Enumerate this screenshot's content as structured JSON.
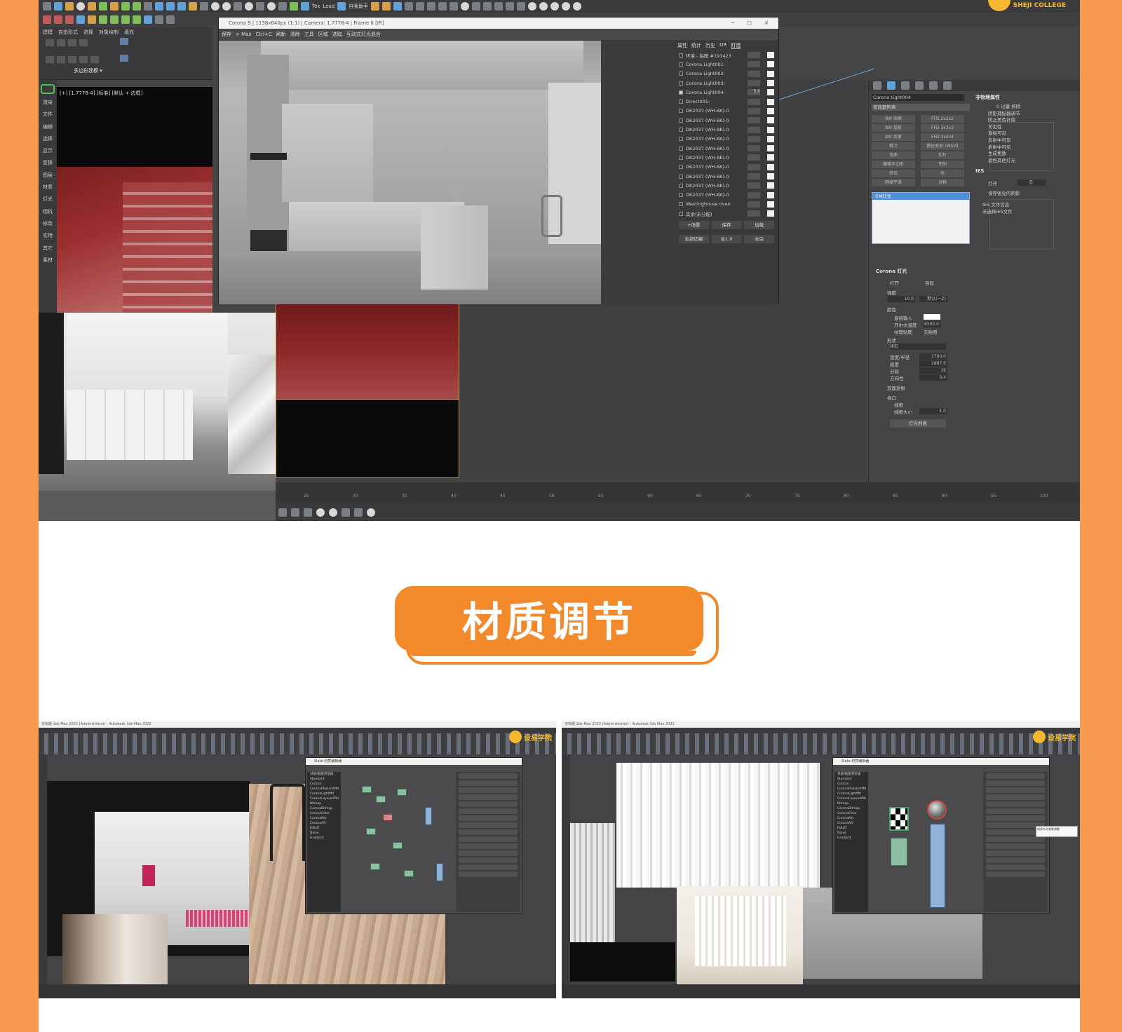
{
  "top_screenshot": {
    "logo_text": "SHEJI COLLEGE",
    "toolbar_text_1": "Tex",
    "toolbar_text_2": "Lead",
    "toolbar_text_3": "自我助手",
    "command_tabs": [
      "建模",
      "自由形式",
      "选择",
      "对象绘制",
      "填充"
    ],
    "command_sub_label": "多边形建模 ▾",
    "left_strip_items": [
      "渲染",
      "文件",
      "编辑",
      "选择",
      "显示",
      "变换",
      "图层",
      "材质",
      "灯光",
      "相机",
      "修改",
      "实用",
      "其它",
      "素材"
    ],
    "viewport_label": "[+] [1.7778-4] [标准] [默认 + 边框]",
    "render_window": {
      "title": "Corona 9 | 1138x640px (1:1) | Camera: 1.7778-4 | Frame 0 [IR]",
      "tools": [
        "保存",
        "> Max",
        "Ctrl+C",
        "刷新",
        "清除",
        "工具",
        "区域",
        "选取",
        "互动式灯光混合"
      ],
      "side_tabs": [
        "属性",
        "统计",
        "历史",
        "DR",
        "灯混"
      ],
      "lights": [
        {
          "name": "环境 - 贴图 #191423",
          "on": false
        },
        {
          "name": "Corona Light001:",
          "on": false
        },
        {
          "name": "Corona Light002:",
          "on": false
        },
        {
          "name": "Corona Light003:",
          "on": false
        },
        {
          "name": "Corona Light004:",
          "on": true,
          "value": "5.0"
        },
        {
          "name": "Direct001:",
          "on": false
        },
        {
          "name": "DK2037 (WH-BK)-0",
          "on": false
        },
        {
          "name": "DK2037 (WH-BK)-0",
          "on": false
        },
        {
          "name": "DK2037 (WH-BK)-0",
          "on": false
        },
        {
          "name": "DK2037 (WH-BK)-0",
          "on": false
        },
        {
          "name": "DK2037 (WH-BK)-0",
          "on": false
        },
        {
          "name": "DK2037 (WH-BK)-0",
          "on": false
        },
        {
          "name": "DK2037 (WH-BK)-0",
          "on": false
        },
        {
          "name": "DK2037 (WH-BK)-0",
          "on": false
        },
        {
          "name": "DK2037 (WH-BK)-0",
          "on": false
        },
        {
          "name": "DK2037 (WH-BK)-0",
          "on": false
        },
        {
          "name": "Westinghouse oven",
          "on": false
        },
        {
          "name": "其余(未分配)",
          "on": false
        }
      ],
      "buttons_row1": [
        "+场景",
        "保存",
        "加载"
      ],
      "buttons_row2": [
        "全部切换",
        "全1.0",
        "全白"
      ]
    },
    "command_right": {
      "object_name": "Corona Light004",
      "dropdown": "修改器列表",
      "grid_buttons": [
        "BW 贴图",
        "FFD 2x2x2",
        "BW 投影",
        "FFD 3x3x3",
        "BW 反射",
        "FFD 4x4x4",
        "推力",
        "路径变形 (WSM)",
        "弯曲",
        "切片",
        "编辑多边形",
        "车削",
        "挤出",
        "壳",
        "网格平滑",
        "对称"
      ],
      "list_selected": "CM灯光",
      "sec_corona_light": "Corona 灯光",
      "chk_on": "打开",
      "chk_target": "目标",
      "intensity_label": "强度",
      "intensity_value": "10.0",
      "unit_value": "默认(一Z)",
      "color_label": "颜色",
      "color_direct": "直接输入",
      "color_kelvin": "开尔文温度",
      "kelvin_value": "6500.0",
      "color_map": "纹理贴图",
      "no_map": "无贴图",
      "shape_label": "形状",
      "shape_value": "矩形",
      "width_label": "宽度/半径",
      "width_value": "1700.0",
      "height_label": "高度",
      "height_value": "2887.6",
      "segments_label": "分段",
      "segments_value": "16",
      "directionality_label": "方向性",
      "directionality_value": "0.4",
      "twosided": "双面发射",
      "viewport_label": "视口",
      "wireframe": "线框",
      "wire_size_label": "线框大小",
      "wire_size_value": "1.0",
      "light_list_button": "灯光列表",
      "prop_sec": "非物理属性",
      "prop_items": [
        "0 过量 排除",
        "阴影捕捉器调节",
        "防止黑色补偿",
        "可见性",
        "直接可见",
        "反射中可见",
        "折射中可见",
        "生成焦散",
        "遮挡其他灯光"
      ],
      "ies_sec": "IES",
      "ies_on": "打开",
      "ies_none": "无",
      "ies_keep": "保存锐化的阴影",
      "ies_info": "IES 文件信息",
      "ies_none_file": "未选择IES文件"
    },
    "timeline_ticks": [
      "25",
      "30",
      "35",
      "40",
      "45",
      "50",
      "55",
      "60",
      "65",
      "70",
      "75",
      "80",
      "85",
      "90",
      "95",
      "100"
    ]
  },
  "banner": {
    "title": "材质调节"
  },
  "bottom_left": {
    "titlebar": "无标题-3ds Max 2022 (Administrator) - Autodesk 3ds Max 2022",
    "logo_text": "设易学院",
    "slate_title": "Slate 材质编辑器",
    "slate_list": [
      "材质/贴图浏览器",
      "Standard",
      "Corona",
      "CoronaPhysicalMtl",
      "CoronaLightMtl",
      "CoronaLayeredMtl",
      "Bitmap",
      "CoronaBitmap",
      "CoronaColor",
      "CoronaMix",
      "CoronaAO",
      "Falloff",
      "Noise",
      "Gradient"
    ]
  },
  "bottom_right": {
    "titlebar": "无标题-3ds Max 2022 (Administrator) - Autodesk 3ds Max 2022",
    "logo_text": "设易学院",
    "slate_title": "Slate 材质编辑器",
    "tooltip_text": "材质节点参数调整"
  },
  "colors": {
    "page_bg": "#f79a4f",
    "banner": "#f28a2c",
    "max_ui": "#444446"
  }
}
